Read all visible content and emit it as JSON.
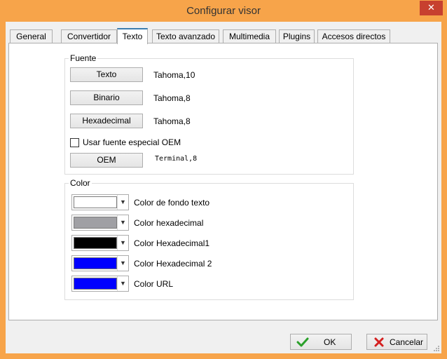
{
  "window": {
    "title": "Configurar visor",
    "close_glyph": "✕"
  },
  "tabs": [
    {
      "label": "General"
    },
    {
      "label": "Convertidor"
    },
    {
      "label": "Texto",
      "selected": true
    },
    {
      "label": "Texto avanzado"
    },
    {
      "label": "Multimedia"
    },
    {
      "label": "Plugins"
    },
    {
      "label": "Accesos directos"
    }
  ],
  "font_group": {
    "title": "Fuente",
    "text_button": "Texto",
    "text_font": "Tahoma,10",
    "binary_button": "Binario",
    "binary_font": "Tahoma,8",
    "hex_button": "Hexadecimal",
    "hex_font": "Tahoma,8",
    "oem_checkbox_label": "Usar fuente especial OEM",
    "oem_checkbox_checked": false,
    "oem_button": "OEM",
    "oem_font": "Terminal,8"
  },
  "color_group": {
    "title": "Color",
    "items": [
      {
        "label": "Color de fondo texto",
        "color": "#ffffff"
      },
      {
        "label": "Color hexadecimal",
        "color": "#a0a0a4"
      },
      {
        "label": "Color Hexadecimal1",
        "color": "#000000"
      },
      {
        "label": "Color Hexadecimal 2",
        "color": "#0000ff"
      },
      {
        "label": "Color URL",
        "color": "#0000ff"
      }
    ]
  },
  "buttons": {
    "ok": "OK",
    "cancel": "Cancelar"
  },
  "colors": {
    "title_bar": "#f7a44a",
    "close_button": "#c7402f",
    "tab_accent": "#3c7fb1"
  },
  "icons": {
    "ok": "checkmark-icon",
    "cancel": "x-icon",
    "dropdown": "chevron-down-icon"
  }
}
